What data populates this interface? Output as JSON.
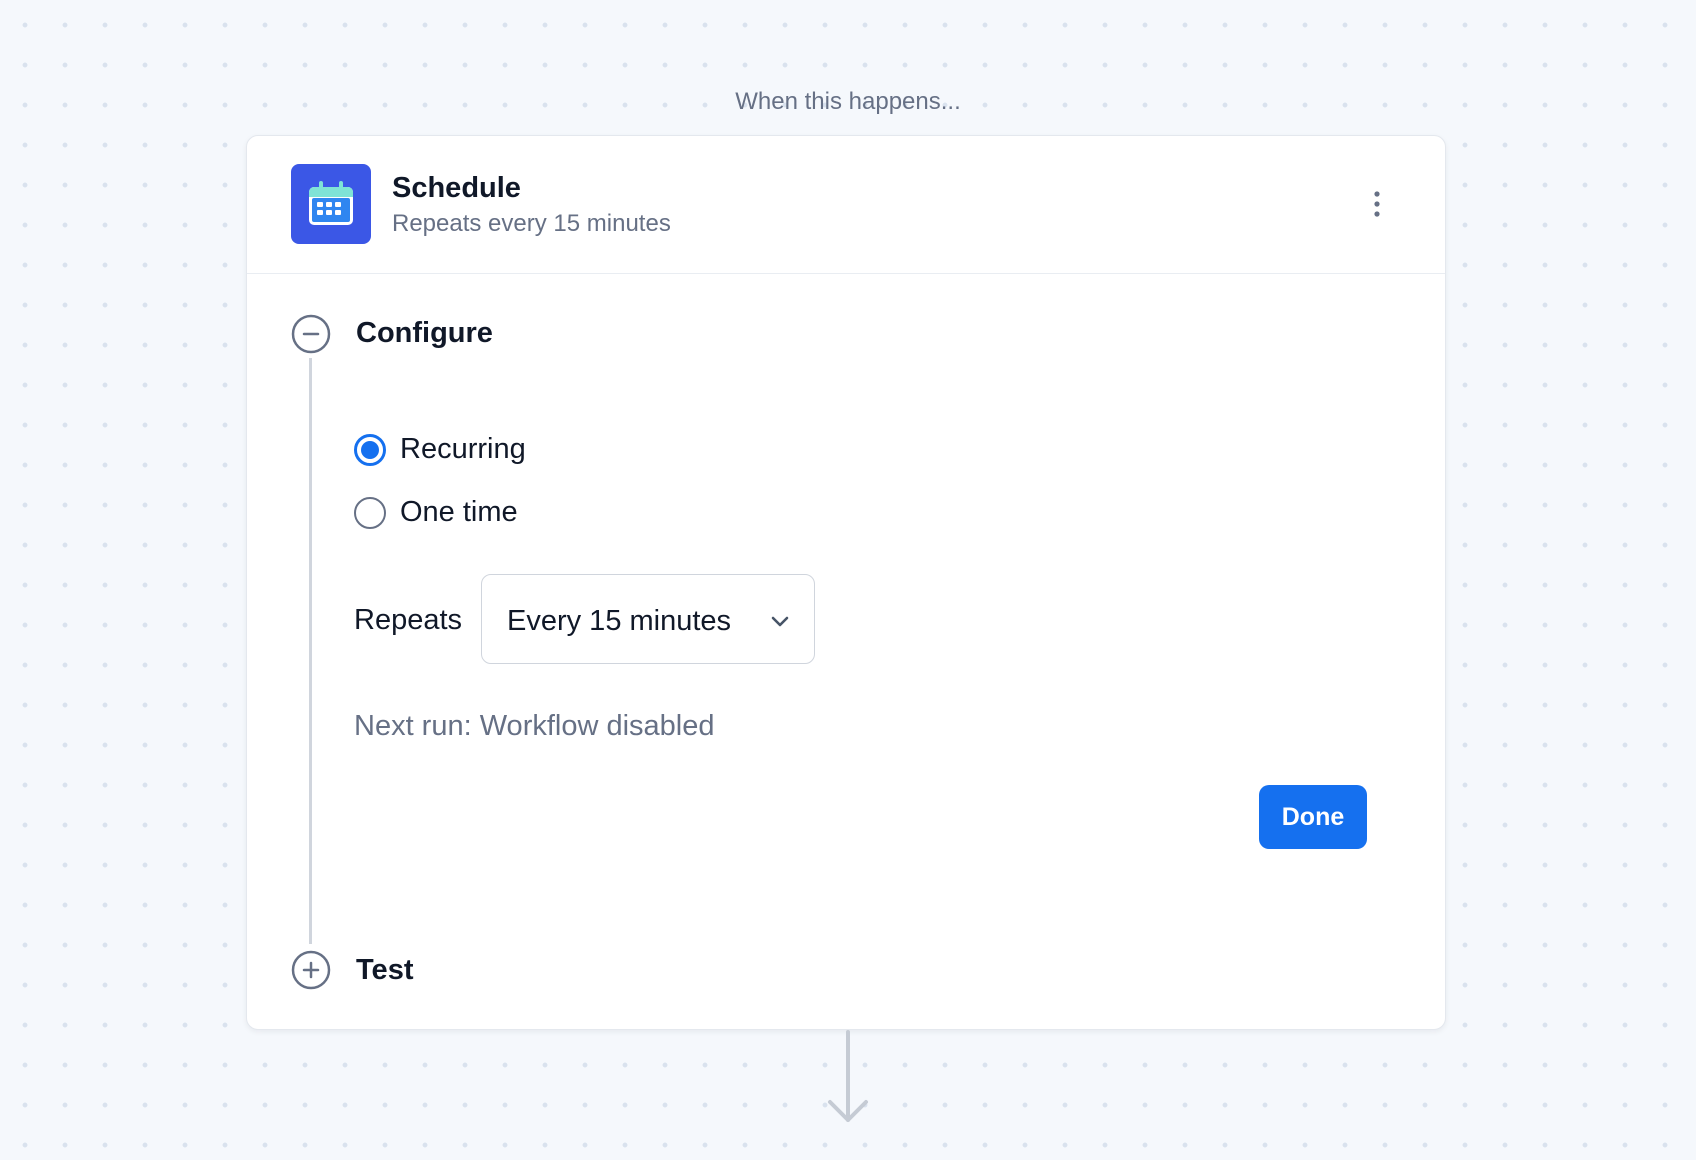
{
  "canvas": {
    "trigger_caption": "When this happens..."
  },
  "trigger_card": {
    "app_icon": "calendar-icon",
    "title": "Schedule",
    "subtitle": "Repeats every 15 minutes",
    "menu_icon": "more-vertical-icon"
  },
  "steps": {
    "configure": {
      "title": "Configure",
      "state": "expanded",
      "toggle_icon": "minus-circle-icon"
    },
    "test": {
      "title": "Test",
      "state": "collapsed",
      "toggle_icon": "plus-circle-icon"
    }
  },
  "configure": {
    "schedule_type": {
      "options": [
        {
          "label": "Recurring",
          "selected": true
        },
        {
          "label": "One time",
          "selected": false
        }
      ]
    },
    "repeats": {
      "label": "Repeats",
      "selected_value": "Every 15 minutes",
      "icon": "chevron-down-icon"
    },
    "next_run_text": "Next run: Workflow disabled",
    "done_label": "Done"
  },
  "colors": {
    "primary": "#1570ef",
    "app_icon_background": "#3b57e6",
    "text_primary": "#101828",
    "text_secondary": "#667085"
  }
}
